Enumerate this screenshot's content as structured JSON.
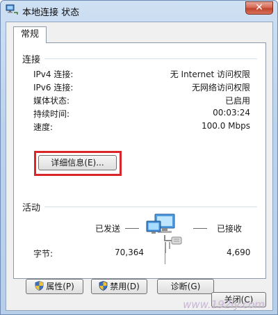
{
  "window": {
    "title": "本地连接 状态",
    "close_glyph": "✕"
  },
  "tabs": [
    {
      "label": "常规"
    }
  ],
  "connection": {
    "group_title": "连接",
    "rows": [
      {
        "label": "IPv4 连接:",
        "value": "无 Internet 访问权限"
      },
      {
        "label": "IPv6 连接:",
        "value": "无网络访问权限"
      },
      {
        "label": "媒体状态:",
        "value": "已启用"
      },
      {
        "label": "持续时间:",
        "value": "00:03:24"
      },
      {
        "label": "速度:",
        "value": "100.0 Mbps"
      }
    ],
    "details_button": "详细信息(E)..."
  },
  "activity": {
    "group_title": "活动",
    "sent_label": "已发送",
    "received_label": "已接收",
    "bytes_label": "字节:",
    "bytes_sent": "70,364",
    "bytes_received": "4,690"
  },
  "buttons": {
    "properties": "属性(P)",
    "disable": "禁用(D)",
    "diagnose": "诊断(G)",
    "close": "关闭(C)"
  },
  "watermark": "www.192ly.com",
  "icons": {
    "title": "network-connection-icon",
    "activity": "network-computers-icon",
    "shield": "uac-shield-icon"
  },
  "colors": {
    "highlight": "#d8262a",
    "title_bar": "#bcd2ec"
  }
}
